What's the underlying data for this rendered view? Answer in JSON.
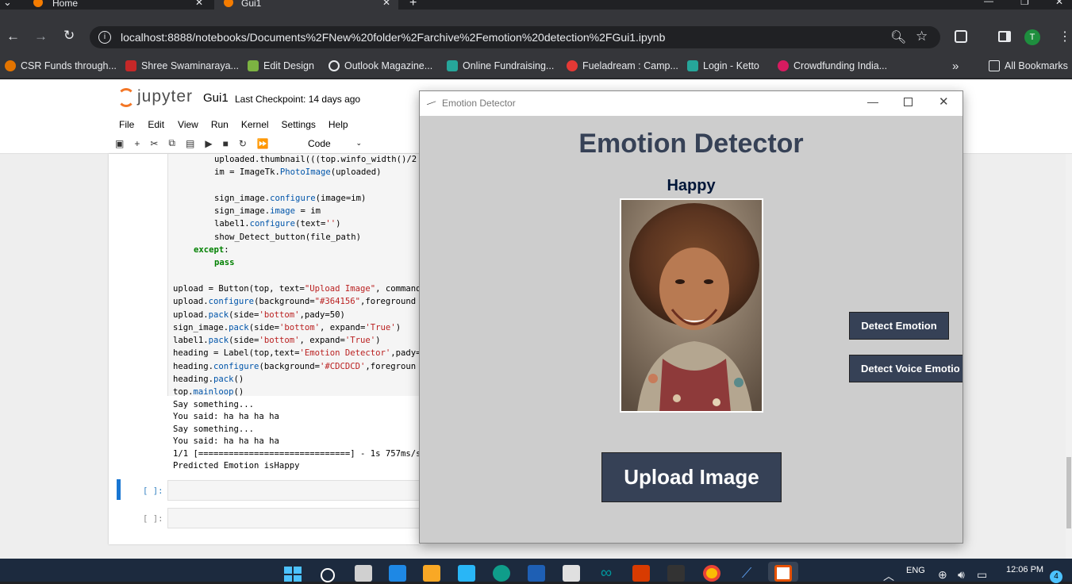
{
  "browser": {
    "tabs": [
      {
        "label": "Home",
        "active": false
      },
      {
        "label": "Gui1",
        "active": true
      }
    ],
    "url": "localhost:8888/notebooks/Documents%2FNew%20folder%2Farchive%2Femotion%20detection%2FGui1.ipynb",
    "profile_initial": "T",
    "bookmarks": [
      {
        "label": "CSR Funds through...",
        "icon": "gear-icon"
      },
      {
        "label": "Shree Swaminaraya...",
        "icon": "site-icon"
      },
      {
        "label": "Edit Design",
        "icon": "edit-icon"
      },
      {
        "label": "Outlook Magazine...",
        "icon": "globe-icon"
      },
      {
        "label": "Online Fundraising...",
        "icon": "ketto-icon"
      },
      {
        "label": "Fueladream : Camp...",
        "icon": "fueladream-icon"
      },
      {
        "label": "Login - Ketto",
        "icon": "ketto-icon"
      },
      {
        "label": "Crowdfunding India...",
        "icon": "crowdfunding-icon"
      }
    ],
    "all_bookmarks": "All Bookmarks",
    "more": "»"
  },
  "jupyter": {
    "logo_text": "jupyter",
    "notebook_name": "Gui1",
    "checkpoint": "Last Checkpoint: 14 days ago",
    "menu": [
      "File",
      "Edit",
      "View",
      "Run",
      "Kernel",
      "Settings",
      "Help"
    ],
    "cell_type": "Code",
    "code_lines": [
      {
        "indent": 2,
        "parts": [
          [
            "",
            "uploaded.thumbnail(((top.winfo_width()/2"
          ]
        ]
      },
      {
        "indent": 2,
        "parts": [
          [
            "",
            "im = ImageTk."
          ],
          [
            "at",
            "PhotoImage"
          ],
          [
            "",
            "(uploaded)"
          ]
        ]
      },
      {
        "indent": 0,
        "parts": [
          [
            "",
            ""
          ]
        ]
      },
      {
        "indent": 2,
        "parts": [
          [
            "",
            "sign_image."
          ],
          [
            "at",
            "configure"
          ],
          [
            "",
            "(image=im)"
          ]
        ]
      },
      {
        "indent": 2,
        "parts": [
          [
            "",
            "sign_image."
          ],
          [
            "at",
            "image"
          ],
          [
            "",
            " = im"
          ]
        ]
      },
      {
        "indent": 2,
        "parts": [
          [
            "",
            "label1."
          ],
          [
            "at",
            "configure"
          ],
          [
            "",
            "(text="
          ],
          [
            "str",
            "''"
          ],
          [
            "",
            ")"
          ]
        ]
      },
      {
        "indent": 2,
        "parts": [
          [
            "",
            "show_Detect_button(file_path)"
          ]
        ]
      },
      {
        "indent": 1,
        "parts": [
          [
            "kw",
            "except"
          ],
          [
            "",
            ":"
          ]
        ]
      },
      {
        "indent": 2,
        "parts": [
          [
            "kw",
            "pass"
          ]
        ]
      },
      {
        "indent": 0,
        "parts": [
          [
            "",
            ""
          ]
        ]
      },
      {
        "indent": 0,
        "parts": [
          [
            "",
            "upload = Button(top, text="
          ],
          [
            "str",
            "\"Upload Image\""
          ],
          [
            "",
            ", command"
          ]
        ]
      },
      {
        "indent": 0,
        "parts": [
          [
            "",
            "upload."
          ],
          [
            "at",
            "configure"
          ],
          [
            "",
            "(background="
          ],
          [
            "str",
            "\"#364156\""
          ],
          [
            "",
            ",foreground"
          ]
        ]
      },
      {
        "indent": 0,
        "parts": [
          [
            "",
            "upload."
          ],
          [
            "at",
            "pack"
          ],
          [
            "",
            "(side="
          ],
          [
            "str",
            "'bottom'"
          ],
          [
            "",
            ",pady=50)"
          ]
        ]
      },
      {
        "indent": 0,
        "parts": [
          [
            "",
            "sign_image."
          ],
          [
            "at",
            "pack"
          ],
          [
            "",
            "(side="
          ],
          [
            "str",
            "'bottom'"
          ],
          [
            "",
            ", expand="
          ],
          [
            "str",
            "'True'"
          ],
          [
            "",
            ")"
          ]
        ]
      },
      {
        "indent": 0,
        "parts": [
          [
            "",
            "label1."
          ],
          [
            "at",
            "pack"
          ],
          [
            "",
            "(side="
          ],
          [
            "str",
            "'bottom'"
          ],
          [
            "",
            ", expand="
          ],
          [
            "str",
            "'True'"
          ],
          [
            "",
            ")"
          ]
        ]
      },
      {
        "indent": 0,
        "parts": [
          [
            "",
            "heading = Label(top,text="
          ],
          [
            "str",
            "'Emotion Detector'"
          ],
          [
            "",
            ",pady="
          ]
        ]
      },
      {
        "indent": 0,
        "parts": [
          [
            "",
            "heading."
          ],
          [
            "at",
            "configure"
          ],
          [
            "",
            "(background="
          ],
          [
            "str",
            "'#CDCDCD'"
          ],
          [
            "",
            ",foregroun"
          ]
        ]
      },
      {
        "indent": 0,
        "parts": [
          [
            "",
            "heading."
          ],
          [
            "at",
            "pack"
          ],
          [
            "",
            "()"
          ]
        ]
      },
      {
        "indent": 0,
        "parts": [
          [
            "",
            "top."
          ],
          [
            "at",
            "mainloop"
          ],
          [
            "",
            "()"
          ]
        ]
      }
    ],
    "output_lines": [
      "Say something...",
      "You said: ha ha ha ha",
      "Say something...",
      "You said: ha ha ha ha",
      "1/1 [==============================] - 1s 757ms/s",
      "Predicted Emotion isHappy"
    ],
    "empty_prompt": "[ ]:"
  },
  "tk_window": {
    "title": "Emotion Detector",
    "heading": "Emotion Detector",
    "emotion_label": "Happy",
    "detect_emotion": "Detect Emotion",
    "detect_voice": "Detect Voice Emotio",
    "upload_button": "Upload Image",
    "bg_color": "#CDCDCD",
    "button_color": "#364156",
    "heading_color": "#364156"
  },
  "taskbar": {
    "language": "ENG",
    "time": "12:06 PM",
    "notif_count": "4"
  }
}
